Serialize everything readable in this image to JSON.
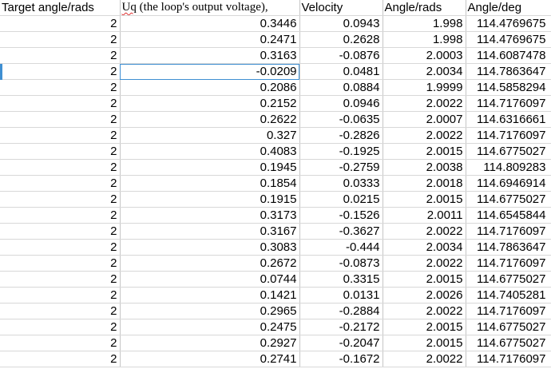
{
  "sheet": {
    "headers": {
      "target_angle": "Target angle/rads",
      "uq_prefix": "Uq",
      "uq_rest": " (the loop's output voltage),",
      "velocity": "Velocity",
      "angle_rads": "Angle/rads",
      "angle_deg": "Angle/deg"
    },
    "selected_row": 3,
    "selection_color": "#3f8fd2",
    "rows": [
      [
        "2",
        "0.3446",
        "0.0943",
        "1.998",
        "114.4769675"
      ],
      [
        "2",
        "0.2471",
        "0.2628",
        "1.998",
        "114.4769675"
      ],
      [
        "2",
        "0.3163",
        "-0.0876",
        "2.0003",
        "114.6087478"
      ],
      [
        "2",
        "-0.0209",
        "0.0481",
        "2.0034",
        "114.7863647"
      ],
      [
        "2",
        "0.2086",
        "0.0884",
        "1.9999",
        "114.5858294"
      ],
      [
        "2",
        "0.2152",
        "0.0946",
        "2.0022",
        "114.7176097"
      ],
      [
        "2",
        "0.2622",
        "-0.0635",
        "2.0007",
        "114.6316661"
      ],
      [
        "2",
        "0.327",
        "-0.2826",
        "2.0022",
        "114.7176097"
      ],
      [
        "2",
        "0.4083",
        "-0.1925",
        "2.0015",
        "114.6775027"
      ],
      [
        "2",
        "0.1945",
        "-0.2759",
        "2.0038",
        "114.809283"
      ],
      [
        "2",
        "0.1854",
        "0.0333",
        "2.0018",
        "114.6946914"
      ],
      [
        "2",
        "0.1915",
        "0.0215",
        "2.0015",
        "114.6775027"
      ],
      [
        "2",
        "0.3173",
        "-0.1526",
        "2.0011",
        "114.6545844"
      ],
      [
        "2",
        "0.3167",
        "-0.3627",
        "2.0022",
        "114.7176097"
      ],
      [
        "2",
        "0.3083",
        "-0.444",
        "2.0034",
        "114.7863647"
      ],
      [
        "2",
        "0.2672",
        "-0.0873",
        "2.0022",
        "114.7176097"
      ],
      [
        "2",
        "0.0744",
        "0.3315",
        "2.0015",
        "114.6775027"
      ],
      [
        "2",
        "0.1421",
        "0.0131",
        "2.0026",
        "114.7405281"
      ],
      [
        "2",
        "0.2965",
        "-0.2884",
        "2.0022",
        "114.7176097"
      ],
      [
        "2",
        "0.2475",
        "-0.2172",
        "2.0015",
        "114.6775027"
      ],
      [
        "2",
        "0.2927",
        "-0.2047",
        "2.0015",
        "114.6775027"
      ],
      [
        "2",
        "0.2741",
        "-0.1672",
        "2.0022",
        "114.7176097"
      ]
    ]
  }
}
